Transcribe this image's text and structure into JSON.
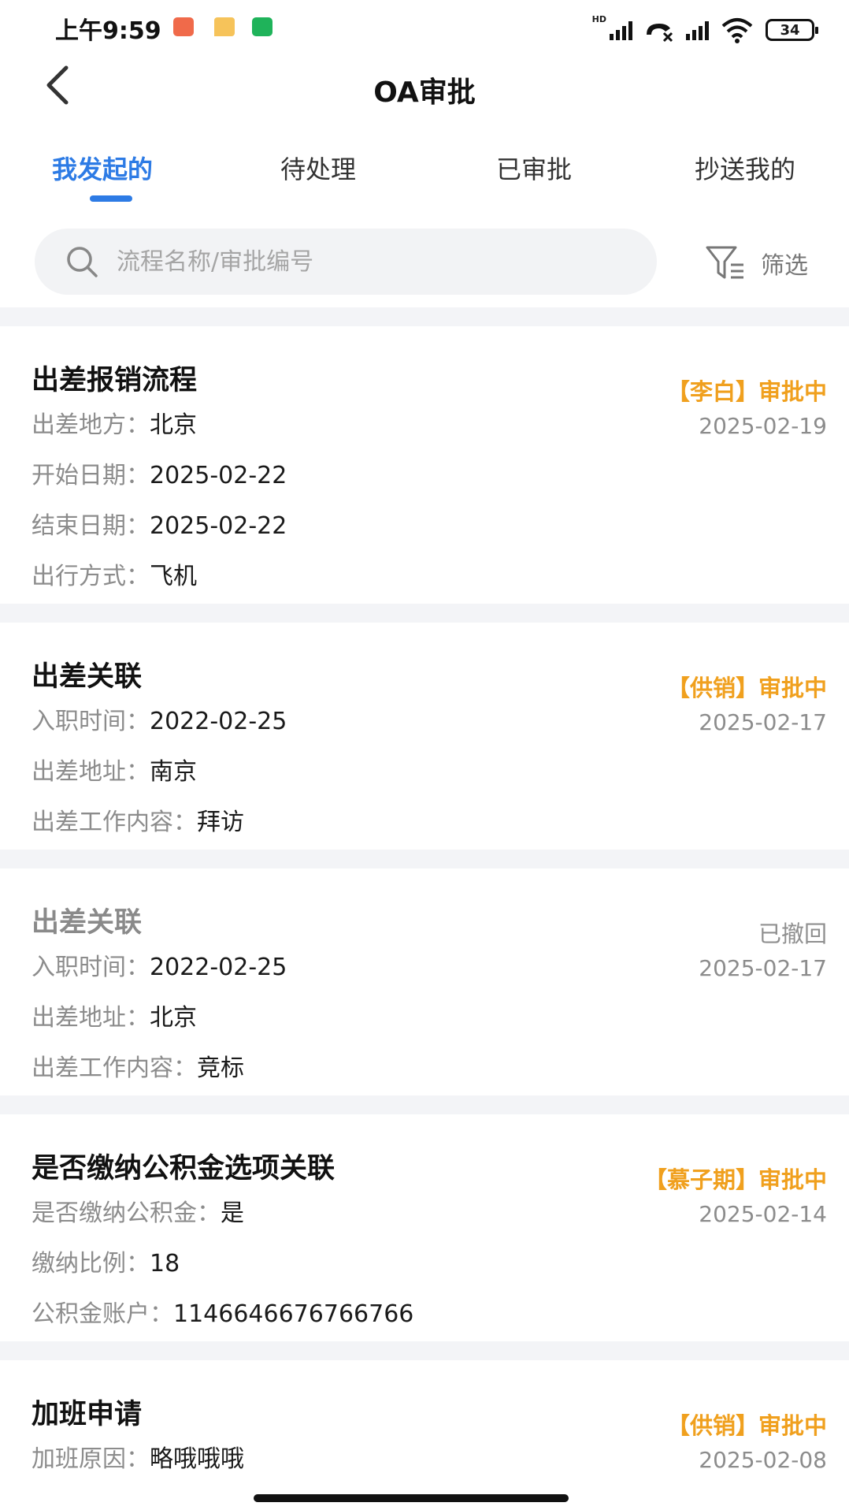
{
  "status_bar": {
    "time": "上午9:59",
    "hd": "HD",
    "battery": "34"
  },
  "header": {
    "title": "OA审批"
  },
  "tabs": [
    {
      "label": "我发起的",
      "active": true
    },
    {
      "label": "待处理",
      "active": false
    },
    {
      "label": "已审批",
      "active": false
    },
    {
      "label": "抄送我的",
      "active": false
    }
  ],
  "search": {
    "placeholder": "流程名称/审批编号"
  },
  "filter": {
    "label": "筛选"
  },
  "cards": [
    {
      "title": "出差报销流程",
      "status": "【李白】审批中",
      "date": "2025-02-19",
      "fields": [
        {
          "label": "出差地方",
          "value": "北京"
        },
        {
          "label": "开始日期",
          "value": "2025-02-22"
        },
        {
          "label": "结束日期",
          "value": "2025-02-22"
        },
        {
          "label": "出行方式",
          "value": "飞机"
        }
      ]
    },
    {
      "title": "出差关联",
      "status": "【供销】审批中",
      "date": "2025-02-17",
      "fields": [
        {
          "label": "入职时间",
          "value": "2022-02-25"
        },
        {
          "label": "出差地址",
          "value": "南京"
        },
        {
          "label": "出差工作内容",
          "value": "拜访"
        }
      ]
    },
    {
      "title": "出差关联",
      "status": "已撤回",
      "date": "2025-02-17",
      "fields": [
        {
          "label": "入职时间",
          "value": "2022-02-25"
        },
        {
          "label": "出差地址",
          "value": "北京"
        },
        {
          "label": "出差工作内容",
          "value": "竞标"
        }
      ]
    },
    {
      "title": "是否缴纳公积金选项关联",
      "status": "【慕子期】审批中",
      "date": "2025-02-14",
      "fields": [
        {
          "label": "是否缴纳公积金",
          "value": "是"
        },
        {
          "label": "缴纳比例",
          "value": "18"
        },
        {
          "label": "公积金账户",
          "value": "114664667676676​6"
        }
      ]
    },
    {
      "title": "加班申请",
      "status": "【供销】审批中",
      "date": "2025-02-08",
      "fields": [
        {
          "label": "加班原因",
          "value": "略哦哦哦"
        }
      ]
    }
  ],
  "colors": {
    "accent": "#2d7be5",
    "pending": "#f0a01e",
    "muted": "#8c8c8c"
  }
}
